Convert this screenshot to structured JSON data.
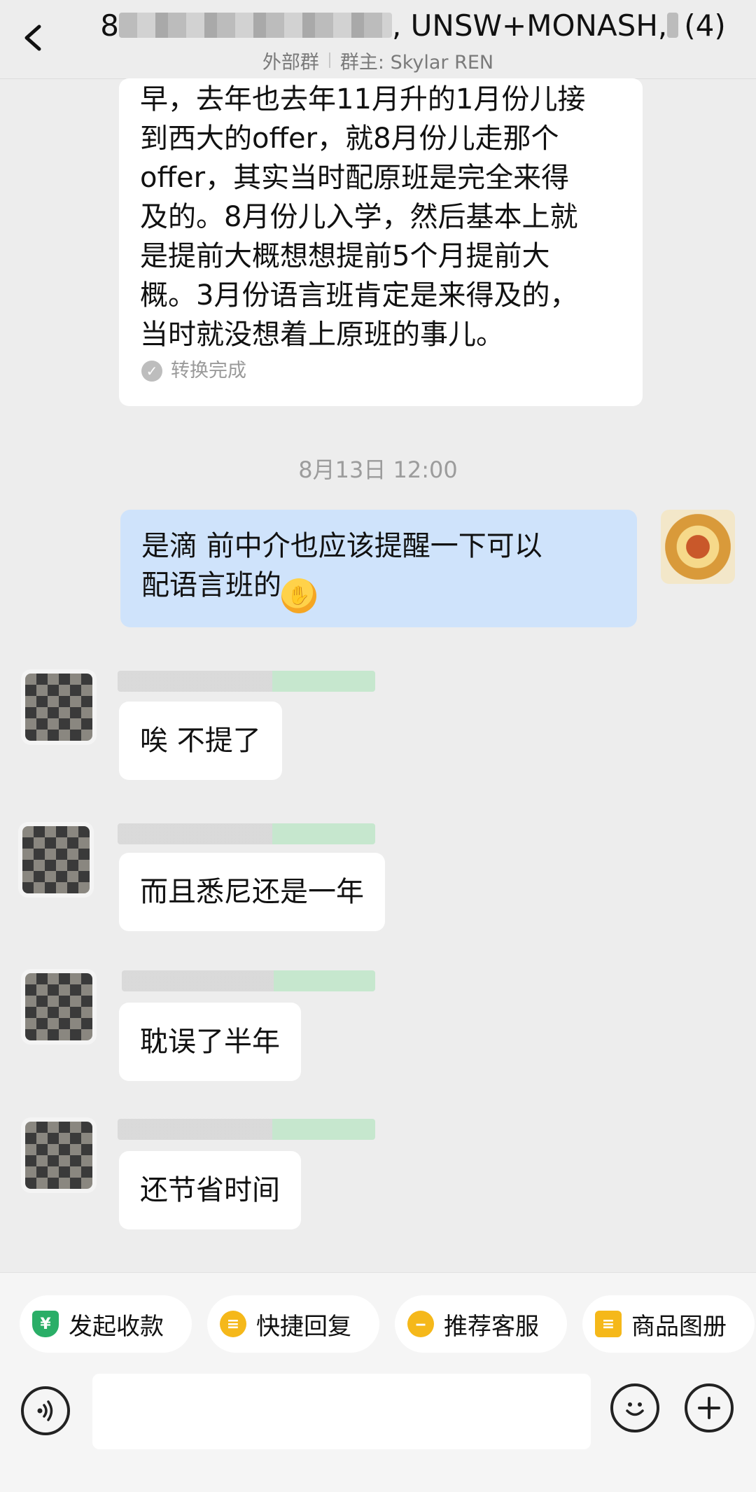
{
  "header": {
    "title_prefix": "8",
    "title_main": ", UNSW+MONASH, ",
    "title_count": "(4)",
    "subtitle_left": "外部群",
    "subtitle_right": "群主: Skylar REN"
  },
  "messages": {
    "first": {
      "lines": [
        "早，去年也去年11月升的1月份儿接",
        "到西大的offer，就8月份儿走那个",
        "offer，其实当时配原班是完全来得",
        "及的。8月份儿入学，然后基本上就",
        "是提前大概想想提前5个月提前大",
        "概。3月份语言班肯定是来得及的，",
        "当时就没想着上原班的事儿。"
      ],
      "convert_label": "转换完成"
    },
    "timestamp": "8月13日 12:00",
    "mine": {
      "line1": "是滴 前中介也应该提醒一下可以",
      "line2": "配语言班的"
    },
    "others": [
      {
        "text": "唉 不提了"
      },
      {
        "text": "而且悉尼还是一年"
      },
      {
        "text": "耽误了半年"
      },
      {
        "text": "还节省时间"
      }
    ]
  },
  "toolbar": {
    "chips": [
      {
        "label": "发起收款",
        "icon": "yen-shield-icon"
      },
      {
        "label": "快捷回复",
        "icon": "quick-reply-icon"
      },
      {
        "label": "推荐客服",
        "icon": "recommend-service-icon"
      },
      {
        "label": "商品图册",
        "icon": "catalog-icon"
      }
    ]
  }
}
